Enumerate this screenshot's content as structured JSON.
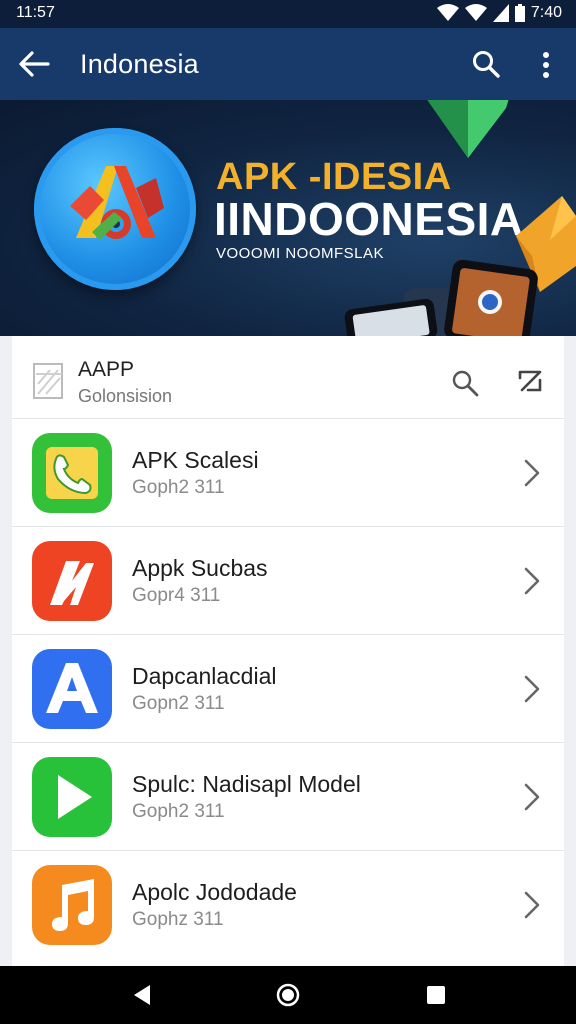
{
  "status_bar": {
    "time_left": "11:57",
    "time_right": "7:40",
    "icons": [
      "wifi-icon",
      "signal-icon",
      "battery-icon"
    ]
  },
  "app_bar": {
    "title": "Indonesia",
    "back_icon": "arrow-left-icon",
    "search_icon": "search-icon",
    "more_icon": "more-vert-icon"
  },
  "banner": {
    "line1": "APK -IDESIA",
    "line2": "IINDOONESIA",
    "line3": "VOOOMI NOOMFSLAK"
  },
  "list_header": {
    "title": "AAPP",
    "subtitle": "Golonsision",
    "search_icon": "search-icon",
    "edit_icon": "edit-icon"
  },
  "apps": [
    {
      "name": "APK Scalesi",
      "meta": "Goph2 311",
      "icon": "phone-app-icon",
      "color": "#34c13a"
    },
    {
      "name": "Appk Sucbas",
      "meta": "Gopr4 311",
      "icon": "a-logo-red-icon",
      "color": "#ee4423"
    },
    {
      "name": "Dapcanlacdial",
      "meta": "Gopn2 311",
      "icon": "a-logo-blue-icon",
      "color": "#2f6ff0"
    },
    {
      "name": "Spulc: Nadisapl Model",
      "meta": "Goph2 311",
      "icon": "play-icon",
      "color": "#27c23a"
    },
    {
      "name": "Apolc Jododade",
      "meta": "Gophz 311",
      "icon": "music-note-icon",
      "color": "#f58b1f"
    }
  ],
  "colors": {
    "status_bg": "#0d1e3a",
    "app_bar_bg": "#173a6a",
    "banner_accent": "#f3b12b"
  }
}
